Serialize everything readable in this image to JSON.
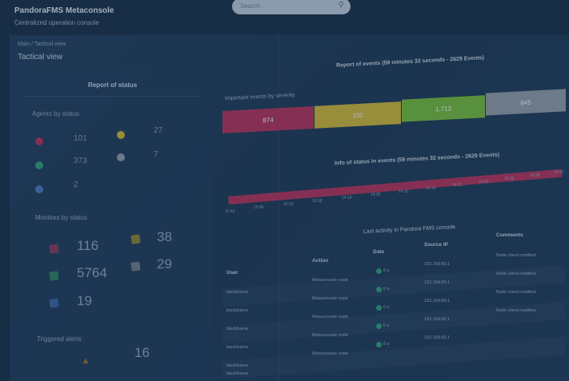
{
  "app": {
    "title": "PandoraFMS Metaconsole",
    "subtitle": "Centralized operation console"
  },
  "search": {
    "placeholder": "Search"
  },
  "breadcrumb": {
    "small": "Main / Tactical view",
    "current": "Tactical view"
  },
  "left": {
    "report_title": "Report of status",
    "agents": {
      "title": "Agents by status",
      "values": [
        "101",
        "27",
        "373",
        "7",
        "2"
      ]
    },
    "monitors": {
      "title": "Monitors by status",
      "values": [
        "116",
        "38",
        "5764",
        "29",
        "19"
      ]
    },
    "alerts": {
      "title": "Triggered alerts",
      "value": "16"
    }
  },
  "events": {
    "report_title": "Report of events (59 minutes 32 seconds - 2629 Events)",
    "severity_label": "Important events by severity",
    "severity": [
      {
        "value": "874",
        "color": "#b0345a"
      },
      {
        "value": "332",
        "color": "#c9b43a"
      },
      {
        "value": "1.713",
        "color": "#74b93c"
      },
      {
        "value": "645",
        "color": "#8e9aa6"
      }
    ],
    "info_title": "Info of status in events (59 minutes 32 seconds - 2629 Events)",
    "ticks": [
      "15:43",
      "15:46",
      "15:15",
      "15:56",
      "14:18",
      "14:56",
      "14:12",
      "14:14",
      "14:21",
      "14:26",
      "14:35",
      "14:36",
      "14:42"
    ]
  },
  "activity": {
    "title": "Last activity in Pandora FMS console",
    "headers": [
      "User",
      "Action",
      "Date",
      "Source IP",
      "Comments"
    ],
    "rows": [
      {
        "user": "blackframe",
        "action": "Metaconsole node",
        "date": "0 s",
        "ip": "192.168.80.1",
        "comment": "Node client modified"
      },
      {
        "user": "blackframe",
        "action": "Metaconsole node",
        "date": "0 s",
        "ip": "192.168.80.1",
        "comment": "Node client modified"
      },
      {
        "user": "blackframe",
        "action": "Metaconsole node",
        "date": "0 s",
        "ip": "192.168.80.1",
        "comment": "Node client modified"
      },
      {
        "user": "blackframe",
        "action": "Metaconsole node",
        "date": "0 s",
        "ip": "192.168.80.1",
        "comment": "Node client modified"
      },
      {
        "user": "blackframe",
        "action": "Metaconsole node",
        "date": "0 s",
        "ip": "192.168.80.1",
        "comment": ""
      },
      {
        "user": "blackframe",
        "action": "",
        "date": "",
        "ip": "",
        "comment": ""
      }
    ]
  }
}
